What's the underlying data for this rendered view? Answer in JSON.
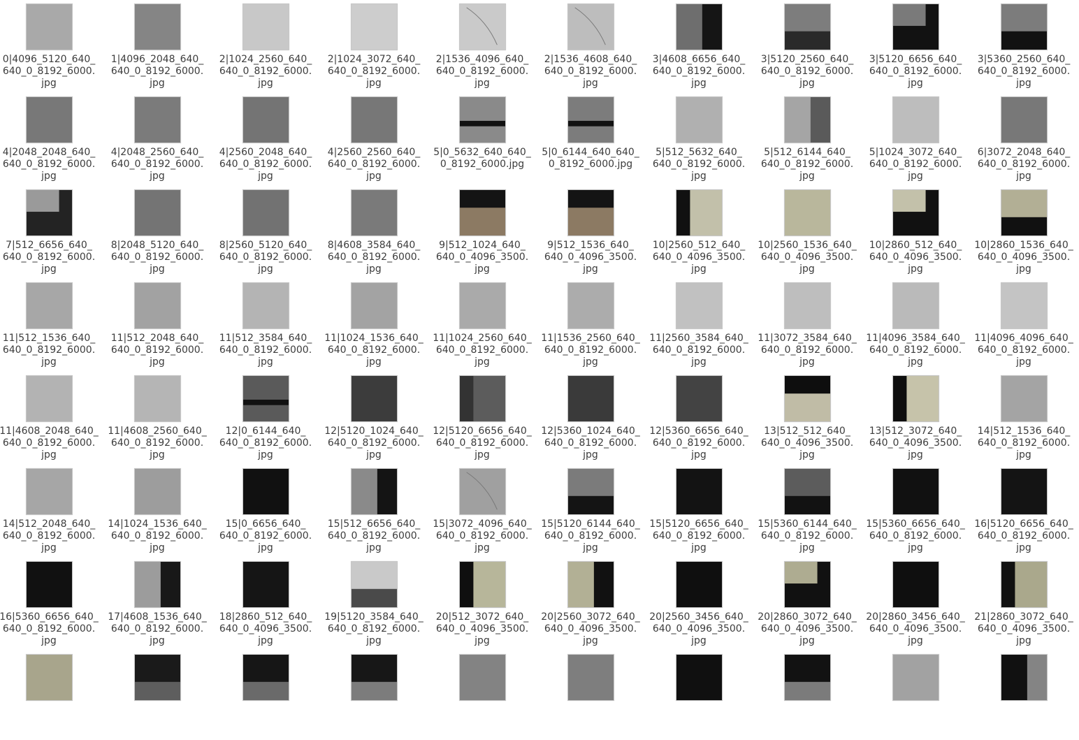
{
  "files": [
    {
      "name": "0|4096_5120_640_\n640_0_8192_6000.\njpg",
      "thumb": "plain-light-gray",
      "c1": "#a9a9a9"
    },
    {
      "name": "1|4096_2048_640_\n640_0_8192_6000.\njpg",
      "thumb": "plain-gray",
      "c1": "#858585"
    },
    {
      "name": "2|1024_2560_640_\n640_0_8192_6000.\njpg",
      "thumb": "plain-light",
      "c1": "#c8c8c8"
    },
    {
      "name": "2|1024_3072_640_\n640_0_8192_6000.\njpg",
      "thumb": "plain-light",
      "c1": "#cdcdcd"
    },
    {
      "name": "2|1536_4096_640_\n640_0_8192_6000.\njpg",
      "thumb": "light-with-curve",
      "c1": "#cacaca"
    },
    {
      "name": "2|1536_4608_640_\n640_0_8192_6000.\njpg",
      "thumb": "light-with-curve",
      "c1": "#bdbdbd"
    },
    {
      "name": "3|4608_6656_640_\n640_0_8192_6000.\njpg",
      "thumb": "gray-left-dark-right",
      "c1": "#6e6e6e",
      "c2": "#151515"
    },
    {
      "name": "3|5120_2560_640_\n640_0_8192_6000.\njpg",
      "thumb": "gray-top-dark-bottom",
      "c1": "#7d7d7d",
      "c2": "#2a2a2a"
    },
    {
      "name": "3|5120_6656_640_\n640_0_8192_6000.\njpg",
      "thumb": "gray-corner-dark",
      "c1": "#7a7a7a",
      "c2": "#121212"
    },
    {
      "name": "3|5360_2560_640_\n640_0_8192_6000.\njpg",
      "thumb": "gray-top-dark-bottom",
      "c1": "#7c7c7c",
      "c2": "#121212"
    },
    {
      "name": "4|2048_2048_640_\n640_0_8192_6000.\njpg",
      "thumb": "plain-gray",
      "c1": "#787878"
    },
    {
      "name": "4|2048_2560_640_\n640_0_8192_6000.\njpg",
      "thumb": "plain-gray",
      "c1": "#7b7b7b"
    },
    {
      "name": "4|2560_2048_640_\n640_0_8192_6000.\njpg",
      "thumb": "plain-gray",
      "c1": "#747474"
    },
    {
      "name": "4|2560_2560_640_\n640_0_8192_6000.\njpg",
      "thumb": "plain-gray",
      "c1": "#777777"
    },
    {
      "name": "5|0_5632_640_640_\n0_8192_6000.jpg",
      "thumb": "striped-band",
      "c1": "#8a8a8a",
      "c2": "#111111"
    },
    {
      "name": "5|0_6144_640_640_\n0_8192_6000.jpg",
      "thumb": "striped-band",
      "c1": "#7c7c7c",
      "c2": "#111111"
    },
    {
      "name": "5|512_5632_640_\n640_0_8192_6000.\njpg",
      "thumb": "plain-light-gray",
      "c1": "#b0b0b0"
    },
    {
      "name": "5|512_6144_640_\n640_0_8192_6000.\njpg",
      "thumb": "gray-left-dark-right",
      "c1": "#a5a5a5",
      "c2": "#5a5a5a"
    },
    {
      "name": "5|1024_3072_640_\n640_0_8192_6000.\njpg",
      "thumb": "plain-light",
      "c1": "#bdbdbd"
    },
    {
      "name": "6|3072_2048_640_\n640_0_8192_6000.\njpg",
      "thumb": "plain-gray",
      "c1": "#787878"
    },
    {
      "name": "7|512_6656_640_\n640_0_8192_6000.\njpg",
      "thumb": "gray-corner-dark",
      "c1": "#9a9a9a",
      "c2": "#232323"
    },
    {
      "name": "8|2048_5120_640_\n640_0_8192_6000.\njpg",
      "thumb": "plain-gray",
      "c1": "#747474"
    },
    {
      "name": "8|2560_5120_640_\n640_0_8192_6000.\njpg",
      "thumb": "plain-gray",
      "c1": "#727272"
    },
    {
      "name": "8|4608_3584_640_\n640_0_8192_6000.\njpg",
      "thumb": "plain-gray",
      "c1": "#7a7a7a"
    },
    {
      "name": "9|512_1024_640_\n640_0_4096_3500.\njpg",
      "thumb": "dark-top-wood-bottom",
      "c1": "#8c7a63",
      "c2": "#141414"
    },
    {
      "name": "9|512_1536_640_\n640_0_4096_3500.\njpg",
      "thumb": "dark-top-wood-bottom",
      "c1": "#8c7a63",
      "c2": "#141414"
    },
    {
      "name": "10|2560_512_640_\n640_0_4096_3500.\njpg",
      "thumb": "dark-left-beige-right",
      "c1": "#c2c0aa",
      "c2": "#111111"
    },
    {
      "name": "10|2560_1536_640_\n640_0_4096_3500.\njpg",
      "thumb": "plain-beige",
      "c1": "#b9b79c"
    },
    {
      "name": "10|2860_512_640_\n640_0_4096_3500.\njpg",
      "thumb": "gray-corner-dark",
      "c1": "#c3c1aa",
      "c2": "#111111"
    },
    {
      "name": "10|2860_1536_640_\n640_0_4096_3500.\njpg",
      "thumb": "gray-top-dark-bottom",
      "c1": "#b2af95",
      "c2": "#111111"
    },
    {
      "name": "11|512_1536_640_\n640_0_8192_6000.\njpg",
      "thumb": "plain-light-gray",
      "c1": "#a7a7a7"
    },
    {
      "name": "11|512_2048_640_\n640_0_8192_6000.\njpg",
      "thumb": "plain-light-gray",
      "c1": "#a2a2a2"
    },
    {
      "name": "11|512_3584_640_\n640_0_8192_6000.\njpg",
      "thumb": "plain-light-gray",
      "c1": "#b4b4b4"
    },
    {
      "name": "11|1024_1536_640_\n640_0_8192_6000.\njpg",
      "thumb": "plain-light-gray",
      "c1": "#a3a3a3"
    },
    {
      "name": "11|1024_2560_640_\n640_0_8192_6000.\njpg",
      "thumb": "plain-light-gray",
      "c1": "#aaaaaa"
    },
    {
      "name": "11|1536_2560_640_\n640_0_8192_6000.\njpg",
      "thumb": "plain-light-gray",
      "c1": "#acacac"
    },
    {
      "name": "11|2560_3584_640_\n640_0_8192_6000.\njpg",
      "thumb": "plain-light",
      "c1": "#c1c1c1"
    },
    {
      "name": "11|3072_3584_640_\n640_0_8192_6000.\njpg",
      "thumb": "plain-light",
      "c1": "#bebebe"
    },
    {
      "name": "11|4096_3584_640_\n640_0_8192_6000.\njpg",
      "thumb": "plain-light",
      "c1": "#bababa"
    },
    {
      "name": "11|4096_4096_640_\n640_0_8192_6000.\njpg",
      "thumb": "plain-light",
      "c1": "#c4c4c4"
    },
    {
      "name": "11|4608_2048_640_\n640_0_8192_6000.\njpg",
      "thumb": "plain-light-gray",
      "c1": "#b3b3b3"
    },
    {
      "name": "11|4608_2560_640_\n640_0_8192_6000.\njpg",
      "thumb": "plain-light-gray",
      "c1": "#b5b5b5"
    },
    {
      "name": "12|0_6144_640_\n640_0_8192_6000.\njpg",
      "thumb": "striped-band",
      "c1": "#5a5a5a",
      "c2": "#111111"
    },
    {
      "name": "12|5120_1024_640_\n640_0_8192_6000.\njpg",
      "thumb": "plain-dark",
      "c1": "#3c3c3c"
    },
    {
      "name": "12|5120_6656_640_\n640_0_8192_6000.\njpg",
      "thumb": "dark-left-beige-right",
      "c1": "#5c5c5c",
      "c2": "#333333"
    },
    {
      "name": "12|5360_1024_640_\n640_0_8192_6000.\njpg",
      "thumb": "plain-dark",
      "c1": "#3a3a3a"
    },
    {
      "name": "12|5360_6656_640_\n640_0_8192_6000.\njpg",
      "thumb": "plain-dark",
      "c1": "#434343"
    },
    {
      "name": "13|512_512_640_\n640_0_4096_3500.\njpg",
      "thumb": "dark-top-wood-bottom",
      "c1": "#c0bca6",
      "c2": "#0e0e0e"
    },
    {
      "name": "13|512_3072_640_\n640_0_4096_3500.\njpg",
      "thumb": "dark-left-beige-right",
      "c1": "#c6c3aa",
      "c2": "#0e0e0e"
    },
    {
      "name": "14|512_1536_640_\n640_0_8192_6000.\njpg",
      "thumb": "plain-light-gray",
      "c1": "#a4a4a4"
    },
    {
      "name": "14|512_2048_640_\n640_0_8192_6000.\njpg",
      "thumb": "plain-light-gray",
      "c1": "#a6a6a6"
    },
    {
      "name": "14|1024_1536_640_\n640_0_8192_6000.\njpg",
      "thumb": "plain-light-gray",
      "c1": "#9d9d9d"
    },
    {
      "name": "15|0_6656_640_\n640_0_8192_6000.\njpg",
      "thumb": "plain-dark",
      "c1": "#111111"
    },
    {
      "name": "15|512_6656_640_\n640_0_8192_6000.\njpg",
      "thumb": "gray-left-dark-right",
      "c1": "#8a8a8a",
      "c2": "#141414"
    },
    {
      "name": "15|3072_4096_640_\n640_0_8192_6000.\njpg",
      "thumb": "light-with-curve",
      "c1": "#a0a0a0"
    },
    {
      "name": "15|5120_6144_640_\n640_0_8192_6000.\njpg",
      "thumb": "gray-top-dark-bottom",
      "c1": "#7b7b7b",
      "c2": "#141414"
    },
    {
      "name": "15|5120_6656_640_\n640_0_8192_6000.\njpg",
      "thumb": "plain-dark",
      "c1": "#131313"
    },
    {
      "name": "15|5360_6144_640_\n640_0_8192_6000.\njpg",
      "thumb": "gray-top-dark-bottom",
      "c1": "#5c5c5c",
      "c2": "#121212"
    },
    {
      "name": "15|5360_6656_640_\n640_0_8192_6000.\njpg",
      "thumb": "plain-dark",
      "c1": "#111111"
    },
    {
      "name": "16|5120_6656_640_\n640_0_8192_6000.\njpg",
      "thumb": "plain-dark",
      "c1": "#141414"
    },
    {
      "name": "16|5360_6656_640_\n640_0_8192_6000.\njpg",
      "thumb": "plain-dark",
      "c1": "#111111"
    },
    {
      "name": "17|4608_1536_640_\n640_0_8192_6000.\njpg",
      "thumb": "gray-left-dark-right",
      "c1": "#9c9c9c",
      "c2": "#181818"
    },
    {
      "name": "18|2860_512_640_\n640_0_4096_3500.\njpg",
      "thumb": "plain-dark",
      "c1": "#151515"
    },
    {
      "name": "19|5120_3584_640_\n640_0_8192_6000.\njpg",
      "thumb": "gray-top-dark-bottom",
      "c1": "#c9c9c9",
      "c2": "#4a4a4a"
    },
    {
      "name": "20|512_3072_640_\n640_0_4096_3500.\njpg",
      "thumb": "dark-left-beige-right",
      "c1": "#b7b69a",
      "c2": "#0f0f0f"
    },
    {
      "name": "20|2560_3072_640_\n640_0_4096_3500.\njpg",
      "thumb": "gray-left-dark-right",
      "c1": "#b2b095",
      "c2": "#111111"
    },
    {
      "name": "20|2560_3456_640_\n640_0_4096_3500.\njpg",
      "thumb": "plain-dark",
      "c1": "#0f0f0f"
    },
    {
      "name": "20|2860_3072_640_\n640_0_4096_3500.\njpg",
      "thumb": "gray-corner-dark",
      "c1": "#aeac91",
      "c2": "#111111"
    },
    {
      "name": "20|2860_3456_640_\n640_0_4096_3500.\njpg",
      "thumb": "plain-dark",
      "c1": "#0f0f0f"
    },
    {
      "name": "21|2860_3072_640_\n640_0_4096_3500.\njpg",
      "thumb": "dark-left-beige-right",
      "c1": "#aaa88c",
      "c2": "#111111"
    },
    {
      "name": "",
      "thumb": "plain-beige",
      "c1": "#a8a58c"
    },
    {
      "name": "",
      "thumb": "gray-top-dark-bottom",
      "c1": "#1a1a1a",
      "c2": "#5e5e5e"
    },
    {
      "name": "",
      "thumb": "gray-top-dark-bottom",
      "c1": "#161616",
      "c2": "#6a6a6a"
    },
    {
      "name": "",
      "thumb": "gray-top-dark-bottom",
      "c1": "#171717",
      "c2": "#7c7c7c"
    },
    {
      "name": "",
      "thumb": "plain-gray",
      "c1": "#838383"
    },
    {
      "name": "",
      "thumb": "plain-gray",
      "c1": "#7e7e7e"
    },
    {
      "name": "",
      "thumb": "plain-dark",
      "c1": "#101010"
    },
    {
      "name": "",
      "thumb": "gray-top-dark-bottom",
      "c1": "#121212",
      "c2": "#7b7b7b"
    },
    {
      "name": "",
      "thumb": "plain-light-gray",
      "c1": "#a2a2a2"
    },
    {
      "name": "",
      "thumb": "gray-left-dark-right",
      "c1": "#111111",
      "c2": "#848484"
    }
  ]
}
